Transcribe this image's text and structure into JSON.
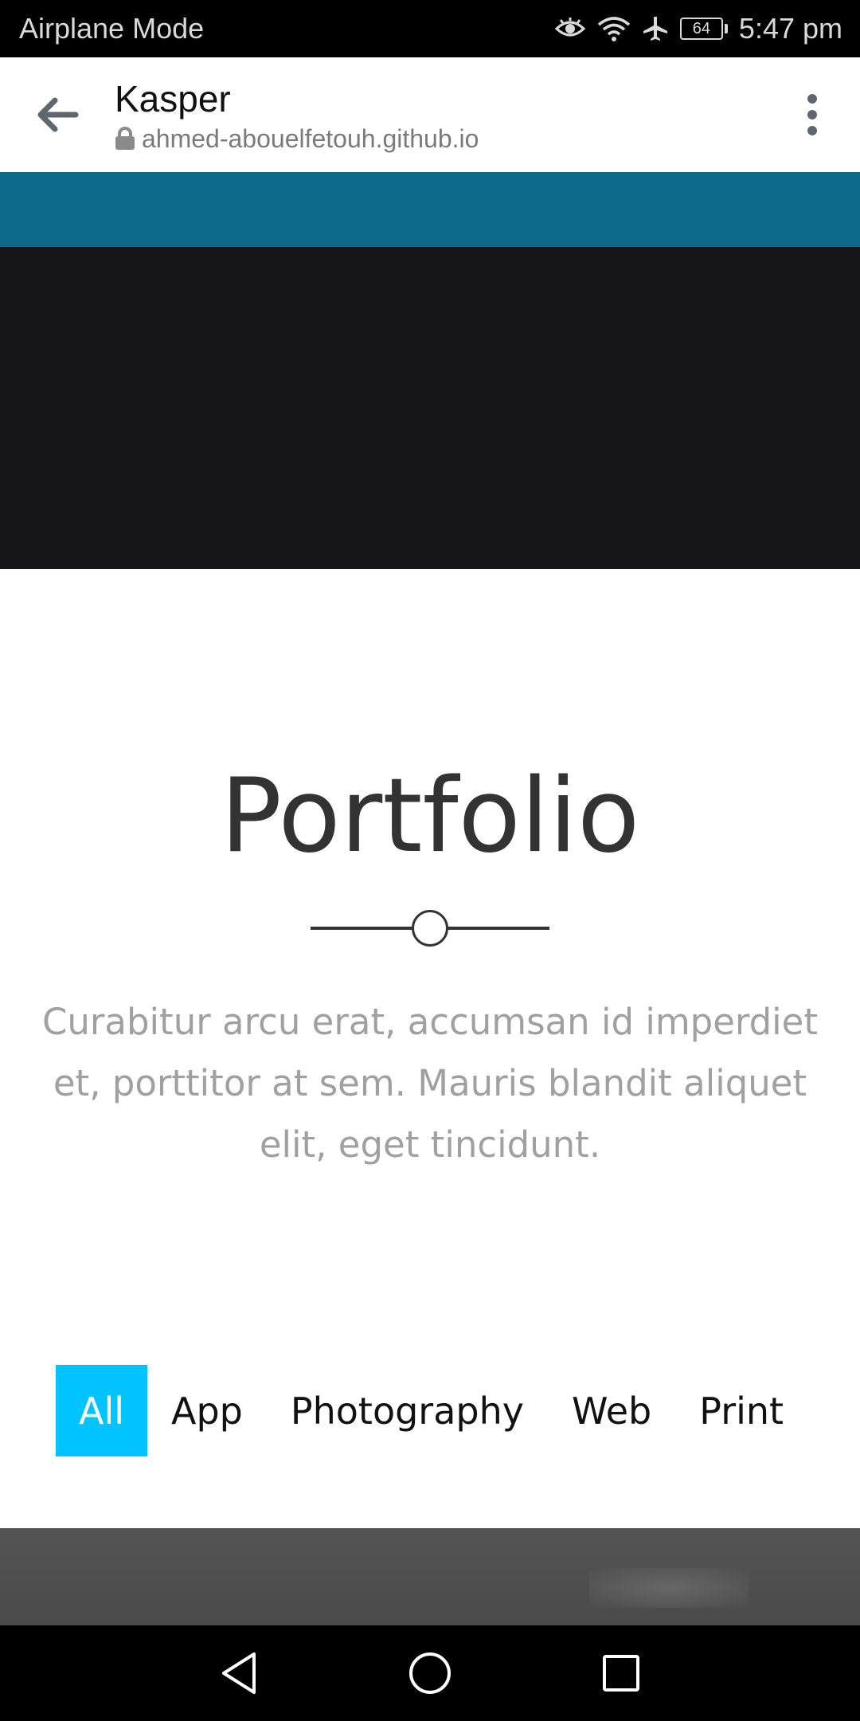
{
  "status_bar": {
    "mode_label": "Airplane Mode",
    "battery_level": "64",
    "time": "5:47 pm",
    "icons": [
      "eye-icon",
      "wifi-icon",
      "airplane-icon",
      "battery-icon"
    ]
  },
  "browser": {
    "page_title": "Kasper",
    "url": "ahmed-abouelfetouh.github.io",
    "icons": [
      "back-arrow-icon",
      "lock-icon",
      "more-vert-icon"
    ]
  },
  "portfolio": {
    "title": "Portfolio",
    "description": "Curabitur arcu erat, accumsan id imperdiet et, porttitor at sem. Mauris blandit aliquet elit, eget tincidunt."
  },
  "filters": {
    "items": [
      "All",
      "App",
      "Photography",
      "Web",
      "Print"
    ],
    "active": "All"
  },
  "colors": {
    "teal_nav": "#0c6b8a",
    "dark_hero": "#16161a",
    "filter_active": "#00c3ff",
    "title_text": "#333333",
    "description_text": "#a0a0a0"
  },
  "nav_bar": {
    "icons": [
      "back-triangle-icon",
      "home-circle-icon",
      "recents-square-icon"
    ]
  }
}
